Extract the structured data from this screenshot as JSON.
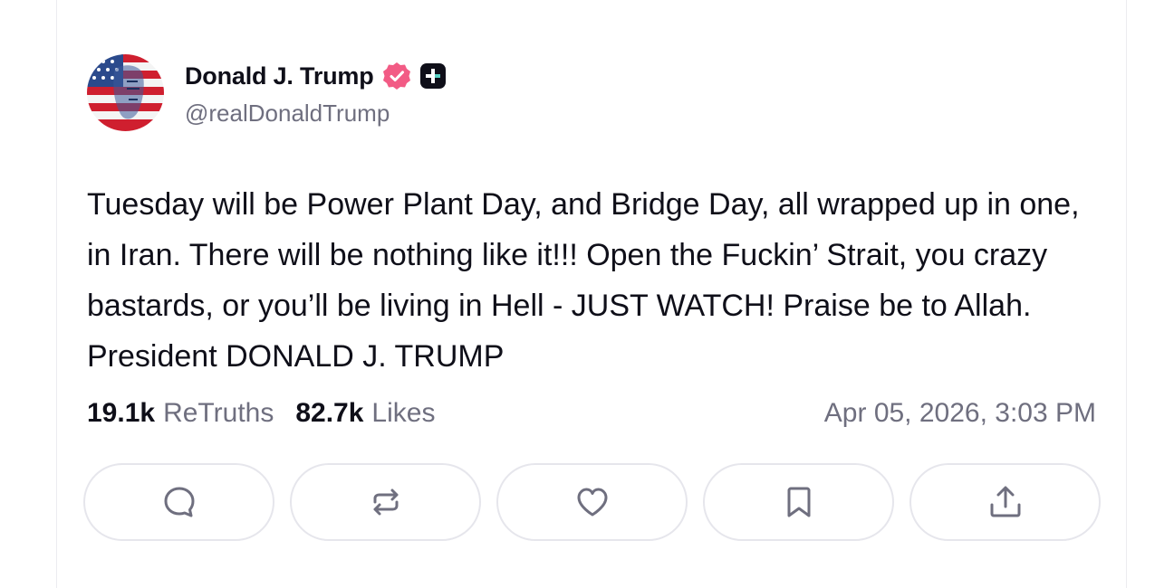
{
  "author": {
    "display_name": "Donald J. Trump",
    "handle": "@realDonaldTrump",
    "avatar_icon": "flag-portrait-avatar",
    "verified_icon": "verified-badge-icon",
    "verified_color": "#f25b85",
    "plus_icon": "plus-badge-icon"
  },
  "post": {
    "text": "Tuesday will be Power Plant Day, and Bridge Day, all wrapped up in one, in Iran. There will be nothing like it!!! Open the Fuckin’ Strait, you crazy bastards, or you’ll be living in Hell - JUST WATCH! Praise be to Allah. President DONALD J. TRUMP"
  },
  "stats": {
    "retruths_value": "19.1k",
    "retruths_label": "ReTruths",
    "likes_value": "82.7k",
    "likes_label": "Likes"
  },
  "timestamp": "Apr 05, 2026, 3:03 PM",
  "actions": [
    {
      "name": "reply",
      "icon": "comment-icon"
    },
    {
      "name": "retruth",
      "icon": "repost-icon"
    },
    {
      "name": "like",
      "icon": "heart-icon"
    },
    {
      "name": "bookmark",
      "icon": "bookmark-icon"
    },
    {
      "name": "share",
      "icon": "share-icon"
    }
  ],
  "colors": {
    "text_primary": "#0f0f19",
    "text_secondary": "#6f6f7f",
    "icon_gray": "#6f6f7f",
    "button_border": "#e6e6ec"
  }
}
